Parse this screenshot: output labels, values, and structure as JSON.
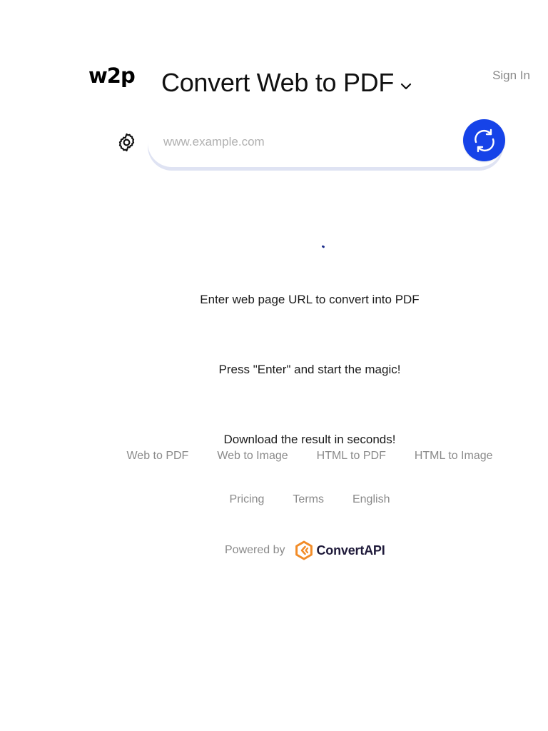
{
  "header": {
    "logo": "w2p",
    "title": "Convert Web to PDF",
    "sign_in": "Sign In"
  },
  "url_input": {
    "placeholder": "www.example.com",
    "value": ""
  },
  "steps": [
    "Enter web page URL to convert into PDF",
    "Press \"Enter\" and start the magic!",
    "Download the result in seconds!"
  ],
  "footer": {
    "tools": [
      "Web to PDF",
      "Web to Image",
      "HTML to PDF",
      "HTML to Image"
    ],
    "links": [
      "Pricing",
      "Terms",
      "English"
    ],
    "powered_by": "Powered by",
    "brand": "ConvertAPI"
  },
  "colors": {
    "accent": "#1643e8",
    "brand_orange": "#f28c28",
    "muted": "#8a8a8a"
  },
  "icons": {
    "settings": "gear-icon",
    "convert": "refresh-icon",
    "title_dropdown": "chevron-down-icon",
    "brand": "convertapi-logo-icon"
  }
}
